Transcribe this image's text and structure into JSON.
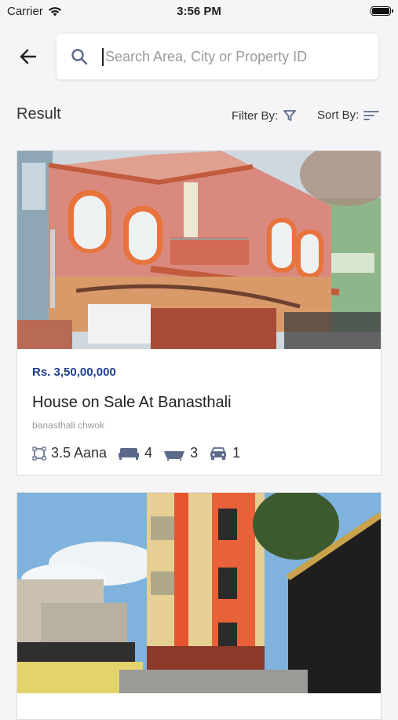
{
  "status_bar": {
    "carrier": "Carrier",
    "time": "3:56 PM"
  },
  "search": {
    "placeholder": "Search Area, City or Property ID"
  },
  "header": {
    "result": "Result",
    "filter_label": "Filter By:",
    "sort_label": "Sort By:"
  },
  "listings": [
    {
      "price": "Rs. 3,50,00,000",
      "title": "House on Sale At Banasthali",
      "location": "banasthali chwok",
      "area": "3.5 Aana",
      "bedrooms": "4",
      "bathrooms": "3",
      "parking": "1"
    }
  ],
  "colors": {
    "price": "#1f3f8f",
    "icon": "#5c6a8a",
    "background": "#f5f5f7"
  }
}
